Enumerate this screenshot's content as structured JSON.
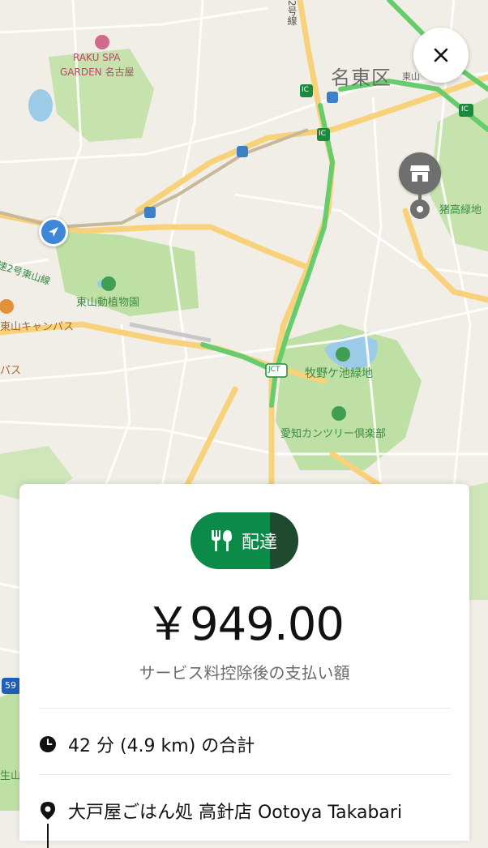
{
  "map": {
    "labels": {
      "raku_spa": "RAKU SPA",
      "raku_garden": "GARDEN 名古屋",
      "meito_ku": "名東区",
      "higashi": "東山",
      "route2": "2号線",
      "inokodaka": "猪高緑地",
      "expressway": "速2号東山線",
      "zoo": "東山動植物園",
      "higashiyama_campus": "東山キャンパス",
      "campus2": "パス",
      "makinogaike": "牧野ケ池緑地",
      "aichi_cc": "愛知カンツリー倶楽部",
      "ic1": "IC",
      "ic2": "IC",
      "ic3": "IC",
      "jct": "JCT",
      "route59": "59",
      "ikusan": "生山"
    },
    "colors": {
      "land": "#f1eee7",
      "park": "#bfe0a5",
      "water": "#9ccbe8",
      "major_road": "#f7d27a",
      "highway_green": "#67cc6b"
    }
  },
  "controls": {
    "close_icon": "close-icon"
  },
  "card": {
    "badge_label": "配達",
    "badge_icon": "restaurant-icon",
    "price": "￥949.00",
    "subtitle": "サービス料控除後の支払い額",
    "trip_summary": "42 分 (4.9 km) の合計",
    "pickup_location": "大戸屋ごはん処 高針店 Ootoya Takabari",
    "colors": {
      "badge_green": "#0c8a47",
      "badge_dark": "#1f4a2f"
    }
  }
}
